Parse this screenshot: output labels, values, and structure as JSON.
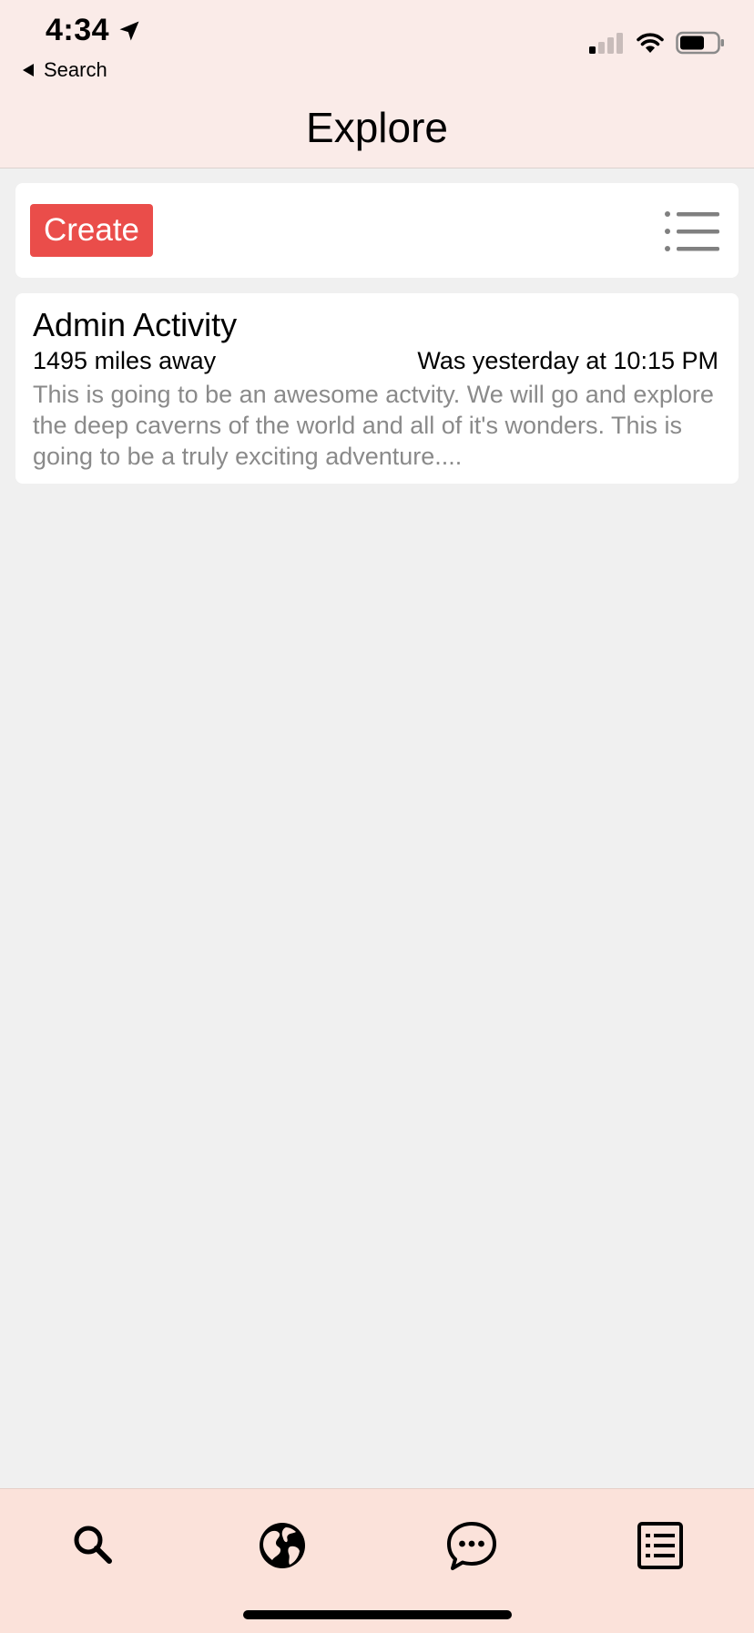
{
  "status_bar": {
    "time": "4:34",
    "back_label": "Search"
  },
  "header": {
    "title": "Explore"
  },
  "toolbar": {
    "create_label": "Create"
  },
  "activities": [
    {
      "title": "Admin Activity",
      "distance": "1495 miles away",
      "time": "Was yesterday at 10:15 PM",
      "description": "This is going to be an awesome actvity. We will go and explore the deep caverns of the world and all of it's wonders. This is going to be a truly exciting adventure...."
    }
  ],
  "tab_bar": {
    "tabs": [
      {
        "icon": "search-icon"
      },
      {
        "icon": "globe-icon"
      },
      {
        "icon": "chat-icon"
      },
      {
        "icon": "list-icon"
      }
    ]
  },
  "colors": {
    "header_bg": "#faebe8",
    "page_bg": "#f0f0f0",
    "accent": "#ea4d4a",
    "tab_bar_bg": "#fbe2da",
    "secondary_text": "#8a8a8a"
  }
}
